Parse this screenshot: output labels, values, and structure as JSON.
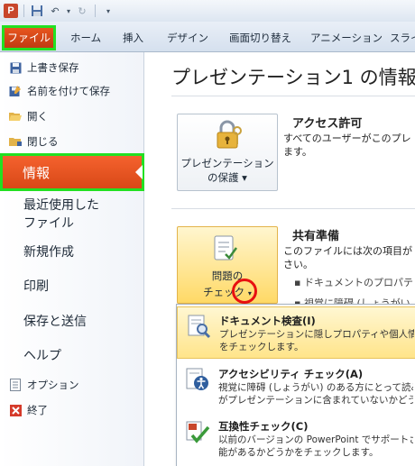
{
  "colors": {
    "file_tab": "#d84817",
    "highlight_border": "#22e022",
    "red_circle": "#e81010",
    "menu_active": "#ffe48a"
  },
  "qat": {
    "app_icon": "P"
  },
  "ribbon_tabs": {
    "file": "ファイル",
    "home": "ホーム",
    "insert": "挿入",
    "design": "デザイン",
    "transitions": "画面切り替え",
    "animations": "アニメーション",
    "slideshow": "スライ"
  },
  "nav": {
    "save": "上書き保存",
    "save_as": "名前を付けて保存",
    "open": "開く",
    "close": "閉じる",
    "info": "情報",
    "recent_line1": "最近使用した",
    "recent_line2": "ファイル",
    "new": "新規作成",
    "print": "印刷",
    "save_send": "保存と送信",
    "help": "ヘルプ",
    "options": "オプション",
    "exit": "終了"
  },
  "main": {
    "title": "プレゼンテーション1 の情報",
    "protect_btn": {
      "line1": "プレゼンテーション",
      "line2": "の保護 ▾"
    },
    "permissions": {
      "title": "アクセス許可",
      "line1": "すべてのユーザーがこのプレ",
      "line2": "ます。"
    },
    "check_btn": {
      "line1": "問題の",
      "line2": "チェック"
    },
    "prepare": {
      "title": "共有準備",
      "line1": "このファイルには次の項目が",
      "line2": "さい。",
      "bullet1": "ドキュメントのプロパテ",
      "bullet2": "視覚に障碍 (しょうがい"
    }
  },
  "menu": {
    "items": [
      {
        "title": "ドキュメント検査(I)",
        "desc1": "プレゼンテーションに隠しプロパティや個人情報が",
        "desc2": "をチェックします。"
      },
      {
        "title": "アクセシビリティ チェック(A)",
        "desc1": "視覚に障碍 (しょうがい) のある方にとって読み",
        "desc2": "がプレゼンテーションに含まれていないかどうかを"
      },
      {
        "title": "互換性チェック(C)",
        "desc1": "以前のバージョンの PowerPoint でサポートさ",
        "desc2": "能があるかどうかをチェックします。"
      }
    ]
  }
}
